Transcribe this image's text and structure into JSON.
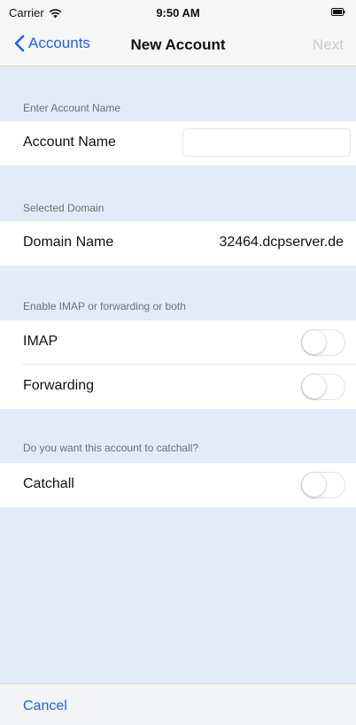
{
  "status_bar": {
    "carrier": "Carrier",
    "time": "9:50 AM",
    "wifi_icon": "wifi-icon",
    "battery_icon": "battery-icon"
  },
  "nav": {
    "back_label": "Accounts",
    "title": "New Account",
    "next_label": "Next",
    "next_enabled": false
  },
  "sections": {
    "account": {
      "header": "Enter Account Name",
      "field_label": "Account Name",
      "field_value": "",
      "field_placeholder": ""
    },
    "domain": {
      "header": "Selected Domain",
      "label": "Domain Name",
      "value": "32464.dcpserver.de"
    },
    "imap_forwarding": {
      "header": "Enable IMAP or forwarding or both",
      "imap_label": "IMAP",
      "imap_on": false,
      "forwarding_label": "Forwarding",
      "forwarding_on": false
    },
    "catchall": {
      "header": "Do you want this account to catchall?",
      "label": "Catchall",
      "catchall_on": false
    }
  },
  "toolbar": {
    "cancel_label": "Cancel"
  },
  "colors": {
    "accent": "#1e62ea",
    "background": "#e3ebf8",
    "disabled": "#c8cbd0"
  }
}
